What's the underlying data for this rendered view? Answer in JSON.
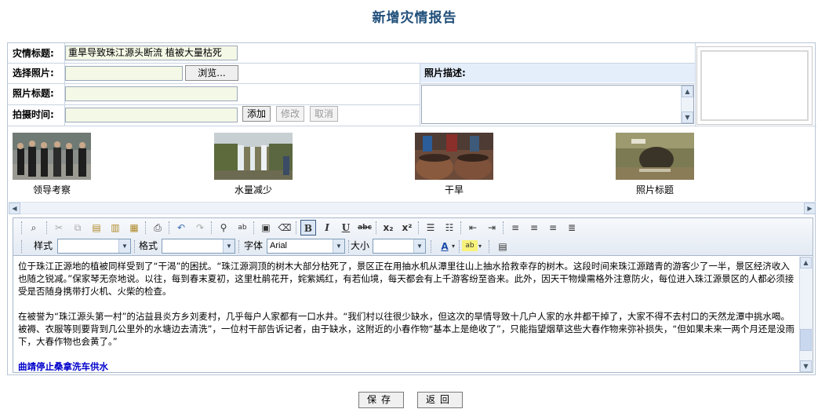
{
  "page": {
    "title": "新增灾情报告"
  },
  "form": {
    "title_label": "灾情标题:",
    "title_value": "重旱导致珠江源头断流 植被大量枯死",
    "photo_label": "选择照片:",
    "browse_label": "浏览...",
    "photo_desc_label": "照片描述:",
    "photo_title_label": "照片标题:",
    "shoot_time_label": "拍摄时间:",
    "add_label": "添加",
    "edit_label": "修改",
    "cancel_label": "取消"
  },
  "thumbnails": [
    {
      "caption": "领导考察",
      "icon": "people-photo"
    },
    {
      "caption": "水量减少",
      "icon": "waterfall-photo"
    },
    {
      "caption": "干旱",
      "icon": "water-jars-photo"
    },
    {
      "caption": "照片标题",
      "icon": "cave-photo"
    }
  ],
  "editor": {
    "style_label": "样式",
    "format_label": "格式",
    "font_label": "字体",
    "font_value": "Arial",
    "size_label": "大小",
    "paragraphs": [
      "位于珠江正源地的植被同样受到了“干渴”的困扰。“珠江源洞顶的树木大部分枯死了，景区正在用抽水机从潭里往山上抽水拾救幸存的树木。这段时间来珠江源踏青的游客少了一半，景区经济收入也随之锐减。”保家琴无奈地说。以往，每到春末夏初，这里杜鹃花开，姹紫嫣红，有若仙境，每天都会有上千游客纷至沓来。此外，因天干物燥需格外注意防火，每位进入珠江源景区的人都必须接受是否随身携带打火机、火柴的检查。",
      "在被誉为“珠江源头第一村”的沾益县炎方乡刘麦村，几乎每户人家都有一口水井。“我们村以往很少缺水，但这次的旱情导致十几户人家的水井都干掉了，大家不得不去村口的天然龙潭中挑水喝。被褥、衣服等则要背到几公里外的水塘边去清洗”，一位村干部告诉记者，由于缺水，这附近的小春作物“基本上是绝收了”，只能指望烟草这些大春作物来弥补损失，“但如果未来一两个月还是没雨下，大春作物也会黄了。”"
    ],
    "link_text": "曲靖停止桑拿洗车供水"
  },
  "actions": {
    "save_label": "保存",
    "back_label": "返回"
  },
  "colors": {
    "title": "#1f4e79",
    "label_bg": "#e4eefb",
    "input_bg": "#f4f8e6",
    "link": "#0000cc"
  }
}
